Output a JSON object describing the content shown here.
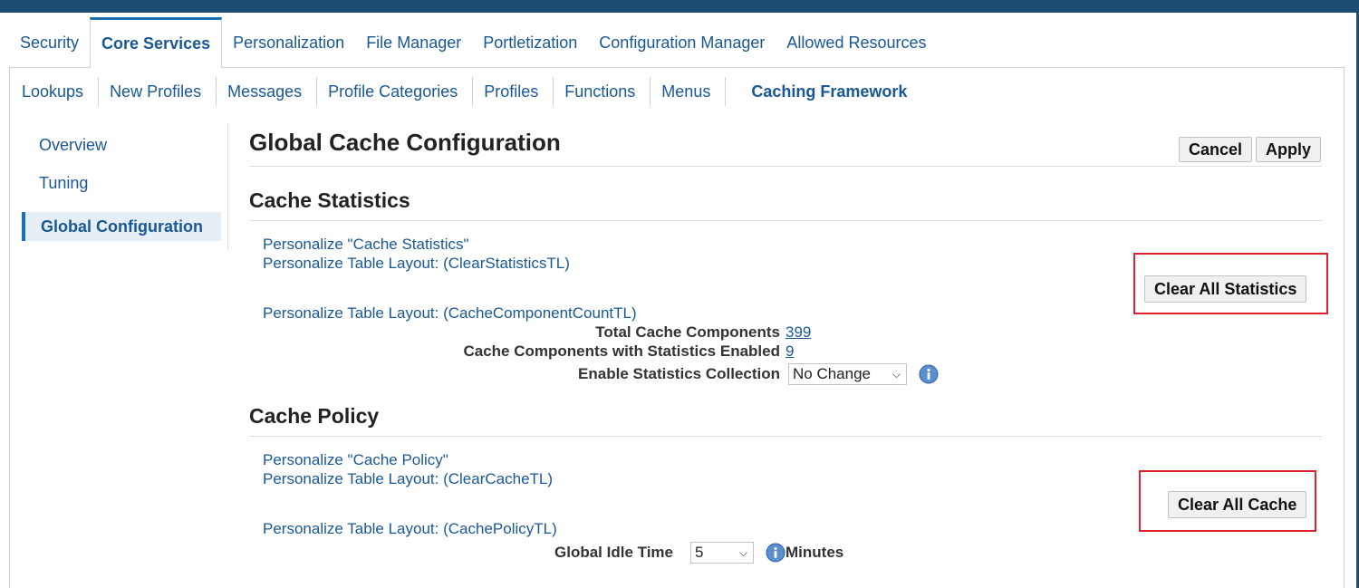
{
  "main_tabs": [
    "Security",
    "Core Services",
    "Personalization",
    "File Manager",
    "Portletization",
    "Configuration Manager",
    "Allowed Resources"
  ],
  "sub_tabs": [
    "Lookups",
    "New Profiles",
    "Messages",
    "Profile Categories",
    "Profiles",
    "Functions",
    "Menus",
    "Caching Framework"
  ],
  "side_nav": [
    "Overview",
    "Tuning",
    "Global Configuration"
  ],
  "page_title": "Global Cache Configuration",
  "buttons": {
    "cancel": "Cancel",
    "apply": "Apply",
    "clear_stats": "Clear All Statistics",
    "clear_cache": "Clear All Cache"
  },
  "stats": {
    "title": "Cache Statistics",
    "personalize": "Personalize \"Cache Statistics\"",
    "layout1": "Personalize Table Layout: (ClearStatisticsTL)",
    "layout2": "Personalize Table Layout: (CacheComponentCountTL)",
    "total_label": "Total Cache Components",
    "total_value": "399",
    "enabled_label": "Cache Components with Statistics Enabled",
    "enabled_value": "9",
    "collection_label": "Enable Statistics Collection",
    "collection_value": "No Change"
  },
  "policy": {
    "title": "Cache Policy",
    "personalize": "Personalize \"Cache Policy\"",
    "layout1": "Personalize Table Layout: (ClearCacheTL)",
    "layout2": "Personalize Table Layout: (CachePolicyTL)",
    "idle_label": "Global Idle Time",
    "idle_value": "5",
    "idle_unit": "Minutes"
  },
  "colors": {
    "link": "#1a5895",
    "highlight_box": "#e0202a",
    "header_bg": "#1f4d72"
  },
  "icons": {
    "info": "info-icon",
    "dropdown": "chevron-down-icon"
  }
}
